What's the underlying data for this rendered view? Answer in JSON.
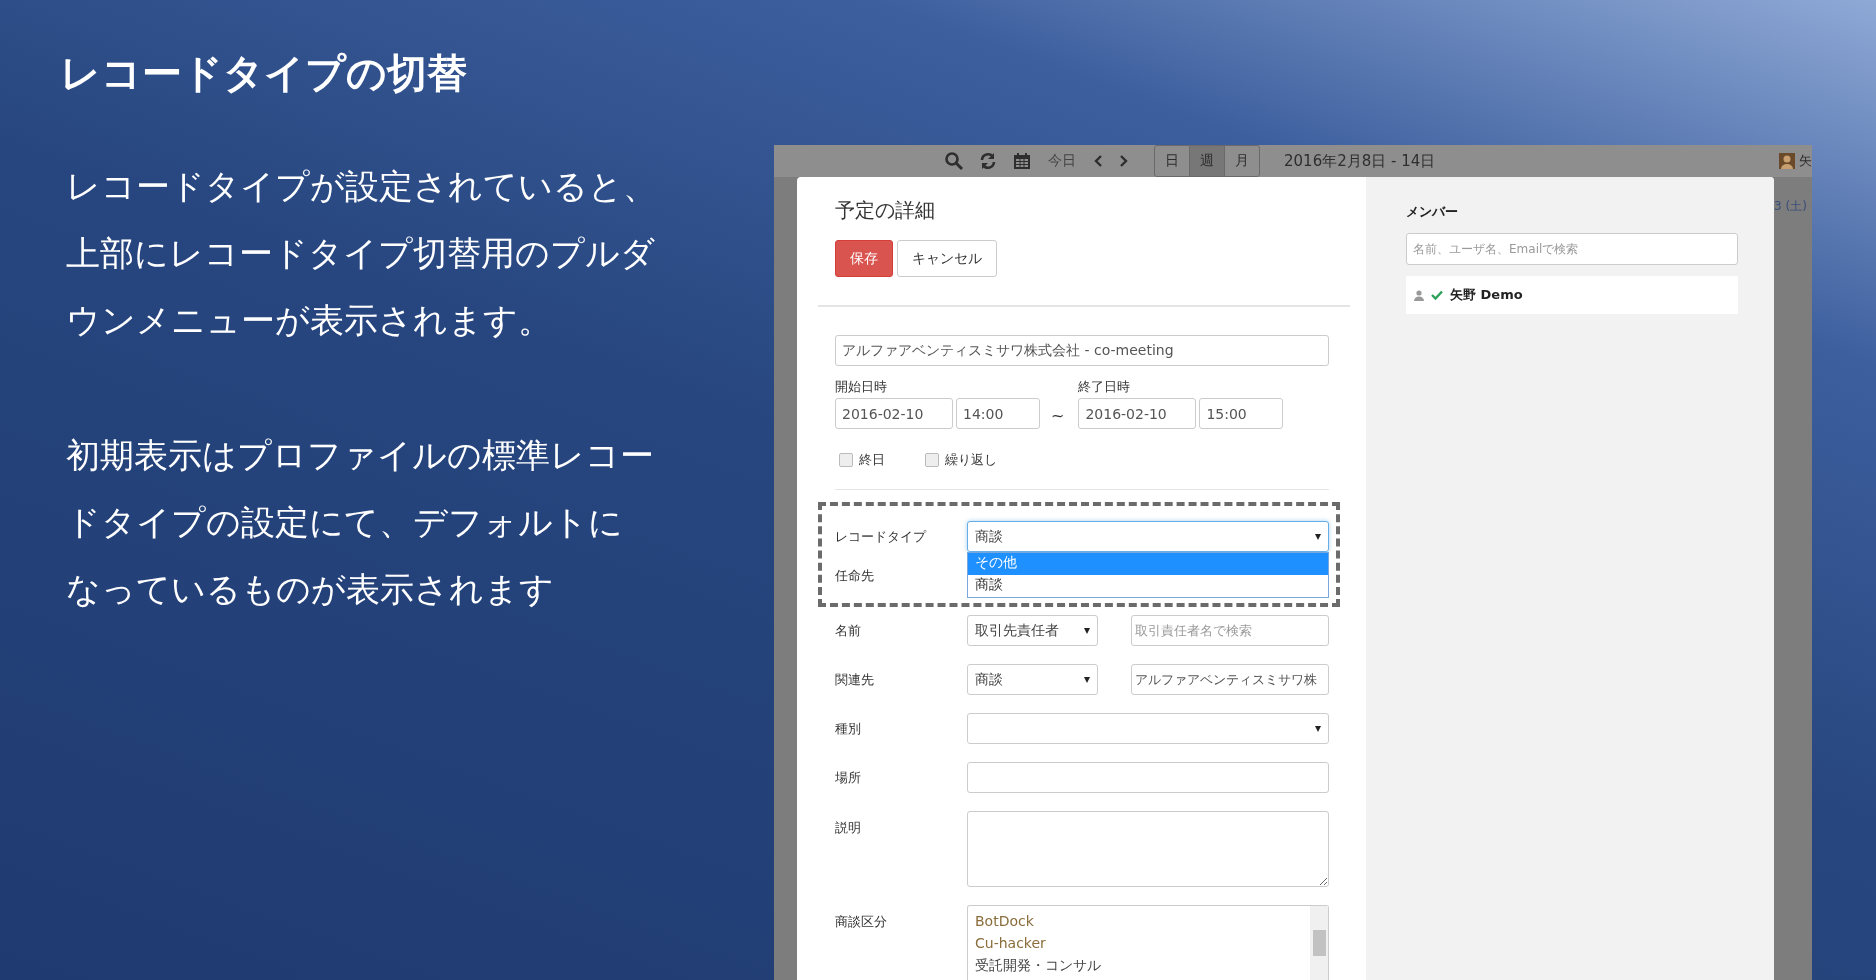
{
  "slide": {
    "title": "レコードタイプの切替",
    "paragraphs": [
      {
        "lines": [
          "レコードタイプが設定されていると、",
          "上部にレコードタイプ切替用のプルダ",
          "ウンメニューが表示されます。"
        ]
      },
      {
        "lines": [
          "初期表示はプロファイルの標準レコー",
          "ドタイプの設定にて、デフォルトに",
          "なっているものが表示されます"
        ]
      }
    ]
  },
  "app": {
    "toolbar": {
      "today": "今日",
      "views": [
        {
          "label": "日",
          "selected": false
        },
        {
          "label": "週",
          "selected": true
        },
        {
          "label": "月",
          "selected": false
        }
      ],
      "range": "2016年2月8日 - 14日",
      "user": "矢"
    },
    "background_right": "3 (土)",
    "dialog": {
      "title": "予定の詳細",
      "save": "保存",
      "cancel": "キャンセル",
      "subject": "アルファアベンティスミサワ株式会社 - co-meeting",
      "start": {
        "label": "開始日時",
        "date": "2016-02-10",
        "time": "14:00"
      },
      "separator": "~",
      "end": {
        "label": "終了日時",
        "date": "2016-02-10",
        "time": "15:00"
      },
      "checkboxes": [
        {
          "label": "終日",
          "checked": false
        },
        {
          "label": "繰り返し",
          "checked": false
        }
      ],
      "record_type": {
        "label": "レコードタイプ",
        "value": "商談",
        "options": [
          {
            "label": "その他",
            "highlighted": true
          },
          {
            "label": "商談",
            "highlighted": false
          }
        ]
      },
      "assignee": {
        "label": "任命先"
      },
      "name": {
        "label": "名前",
        "select": "取引先責任者",
        "placeholder": "取引責任者名で検索"
      },
      "related": {
        "label": "関連先",
        "select": "商談",
        "value": "アルファアベンティスミサワ株"
      },
      "kind": {
        "label": "種別"
      },
      "place": {
        "label": "場所"
      },
      "description": {
        "label": "説明"
      },
      "category": {
        "label": "商談区分",
        "items": [
          "BotDock",
          "Cu-hacker",
          "受託開発・コンサル"
        ]
      },
      "members": {
        "title": "メンバー",
        "placeholder": "名前、ユーザ名、Emailで検索",
        "list": [
          {
            "name": "矢野 Demo",
            "accepted": true
          }
        ]
      }
    }
  }
}
